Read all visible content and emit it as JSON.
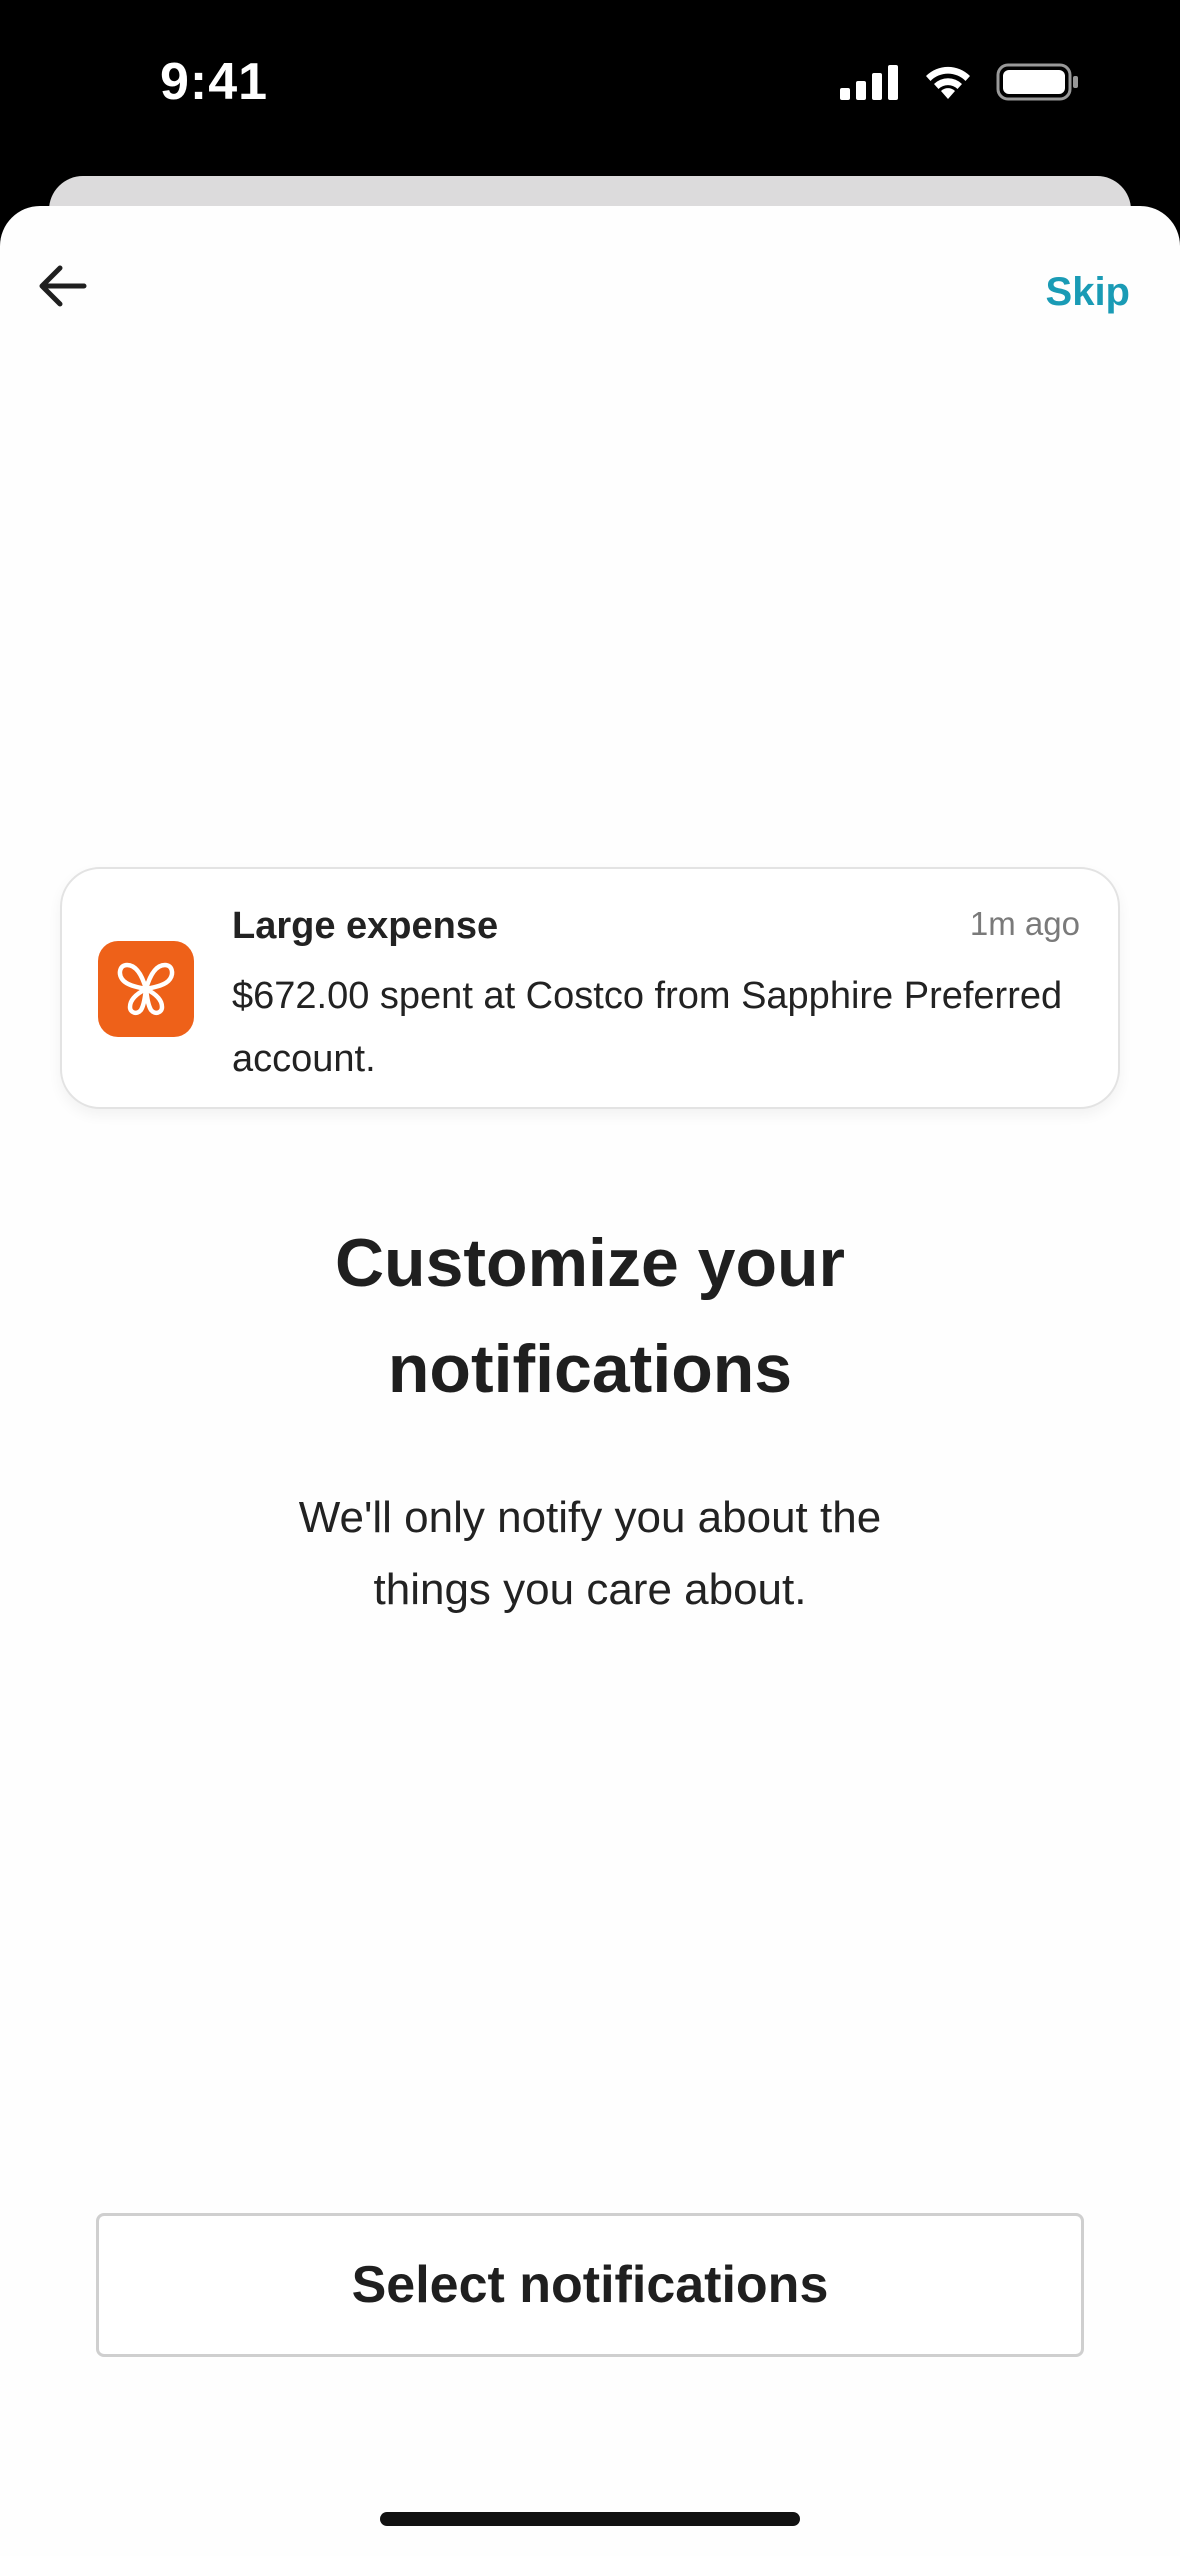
{
  "status_bar": {
    "time": "9:41"
  },
  "header": {
    "back_icon": "arrow-left-icon",
    "skip_label": "Skip"
  },
  "notification_card": {
    "app_icon": "butterfly-icon",
    "title": "Large expense",
    "time": "1m ago",
    "body": "$672.00 spent at Costco from Sapphire Preferred account."
  },
  "main": {
    "headline": "Customize your notifications",
    "subtext": "We'll only notify you about the things you care about."
  },
  "footer": {
    "select_button_label": "Select notifications"
  },
  "colors": {
    "accent": "#1a9bb5",
    "app_icon_bg": "#ee6119",
    "text_primary": "#1f1f1f",
    "text_secondary": "#7a7a7a"
  }
}
